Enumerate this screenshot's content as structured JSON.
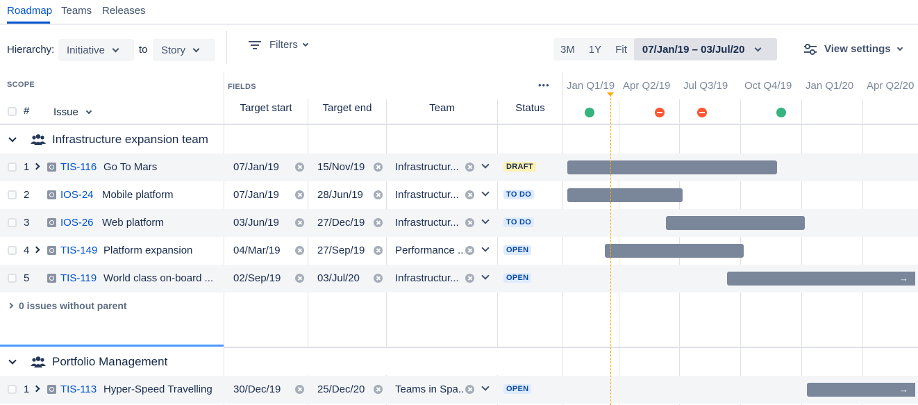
{
  "tabs": [
    {
      "label": "Roadmap",
      "active": true
    },
    {
      "label": "Teams",
      "active": false
    },
    {
      "label": "Releases",
      "active": false
    }
  ],
  "toolbar": {
    "hierarchy_label": "Hierarchy:",
    "hierarchy_from": "Initiative",
    "hierarchy_to_label": "to",
    "hierarchy_to": "Story",
    "filters_label": "Filters",
    "range_3m": "3M",
    "range_1y": "1Y",
    "range_fit": "Fit",
    "date_range": "07/Jan/19 – 03/Jul/20",
    "view_settings": "View settings"
  },
  "columns": {
    "scope": "SCOPE",
    "fields": "FIELDS",
    "more": "•••",
    "number": "#",
    "issue": "Issue",
    "target_start": "Target start",
    "target_end": "Target end",
    "team": "Team",
    "status": "Status"
  },
  "timeline": {
    "quarters": [
      "Jan Q1/19",
      "Apr Q2/19",
      "Jul Q3/19",
      "Oct Q4/19",
      "Jan Q1/20",
      "Apr Q2/20"
    ],
    "quarter_health": [
      "green",
      "red",
      "red",
      "green",
      "",
      ""
    ]
  },
  "groups": [
    {
      "name": "Infrastructure expansion team",
      "rows": [
        {
          "num": "1",
          "expandable": true,
          "key": "TIS-116",
          "summary": "Go To Mars",
          "start": "07/Jan/19",
          "end": "15/Nov/19",
          "team": "Infrastructur...",
          "status": "DRAFT",
          "status_type": "draft",
          "bar_start": "2019-01-07",
          "bar_end": "2019-11-15"
        },
        {
          "num": "2",
          "expandable": false,
          "key": "IOS-24",
          "summary": "Mobile platform",
          "start": "07/Jan/19",
          "end": "28/Jun/19",
          "team": "Infrastructur...",
          "status": "TO DO",
          "status_type": "todo",
          "bar_start": "2019-01-07",
          "bar_end": "2019-06-28"
        },
        {
          "num": "3",
          "expandable": false,
          "key": "IOS-26",
          "summary": "Web platform",
          "start": "03/Jun/19",
          "end": "27/Dec/19",
          "team": "Infrastructur...",
          "status": "TO DO",
          "status_type": "todo",
          "bar_start": "2019-06-03",
          "bar_end": "2019-12-27"
        },
        {
          "num": "4",
          "expandable": true,
          "key": "TIS-149",
          "summary": "Platform expansion",
          "start": "04/Mar/19",
          "end": "27/Sep/19",
          "team": "Performance ...",
          "status": "OPEN",
          "status_type": "open",
          "bar_start": "2019-03-04",
          "bar_end": "2019-09-27"
        },
        {
          "num": "5",
          "expandable": false,
          "key": "TIS-119",
          "summary": "World class on-board ...",
          "start": "02/Sep/19",
          "end": "03/Jul/20",
          "team": "Infrastructur...",
          "status": "OPEN",
          "status_type": "open",
          "bar_start": "2019-09-02",
          "bar_end": "2020-07-03"
        }
      ],
      "without_parent": "0 issues without parent"
    },
    {
      "name": "Portfolio Management",
      "rows": [
        {
          "num": "1",
          "expandable": true,
          "key": "TIS-113",
          "summary": "Hyper-Speed Travelling",
          "start": "30/Dec/19",
          "end": "25/Dec/20",
          "team": "Teams in Spa...",
          "status": "OPEN",
          "status_type": "open",
          "bar_start": "2019-12-30",
          "bar_end": "2020-12-25"
        }
      ]
    }
  ],
  "colors": {
    "accent": "#0052cc",
    "bar": "#7a869a",
    "today": "#ffab00",
    "health_green": "#36b37e",
    "health_red": "#ff5630"
  }
}
